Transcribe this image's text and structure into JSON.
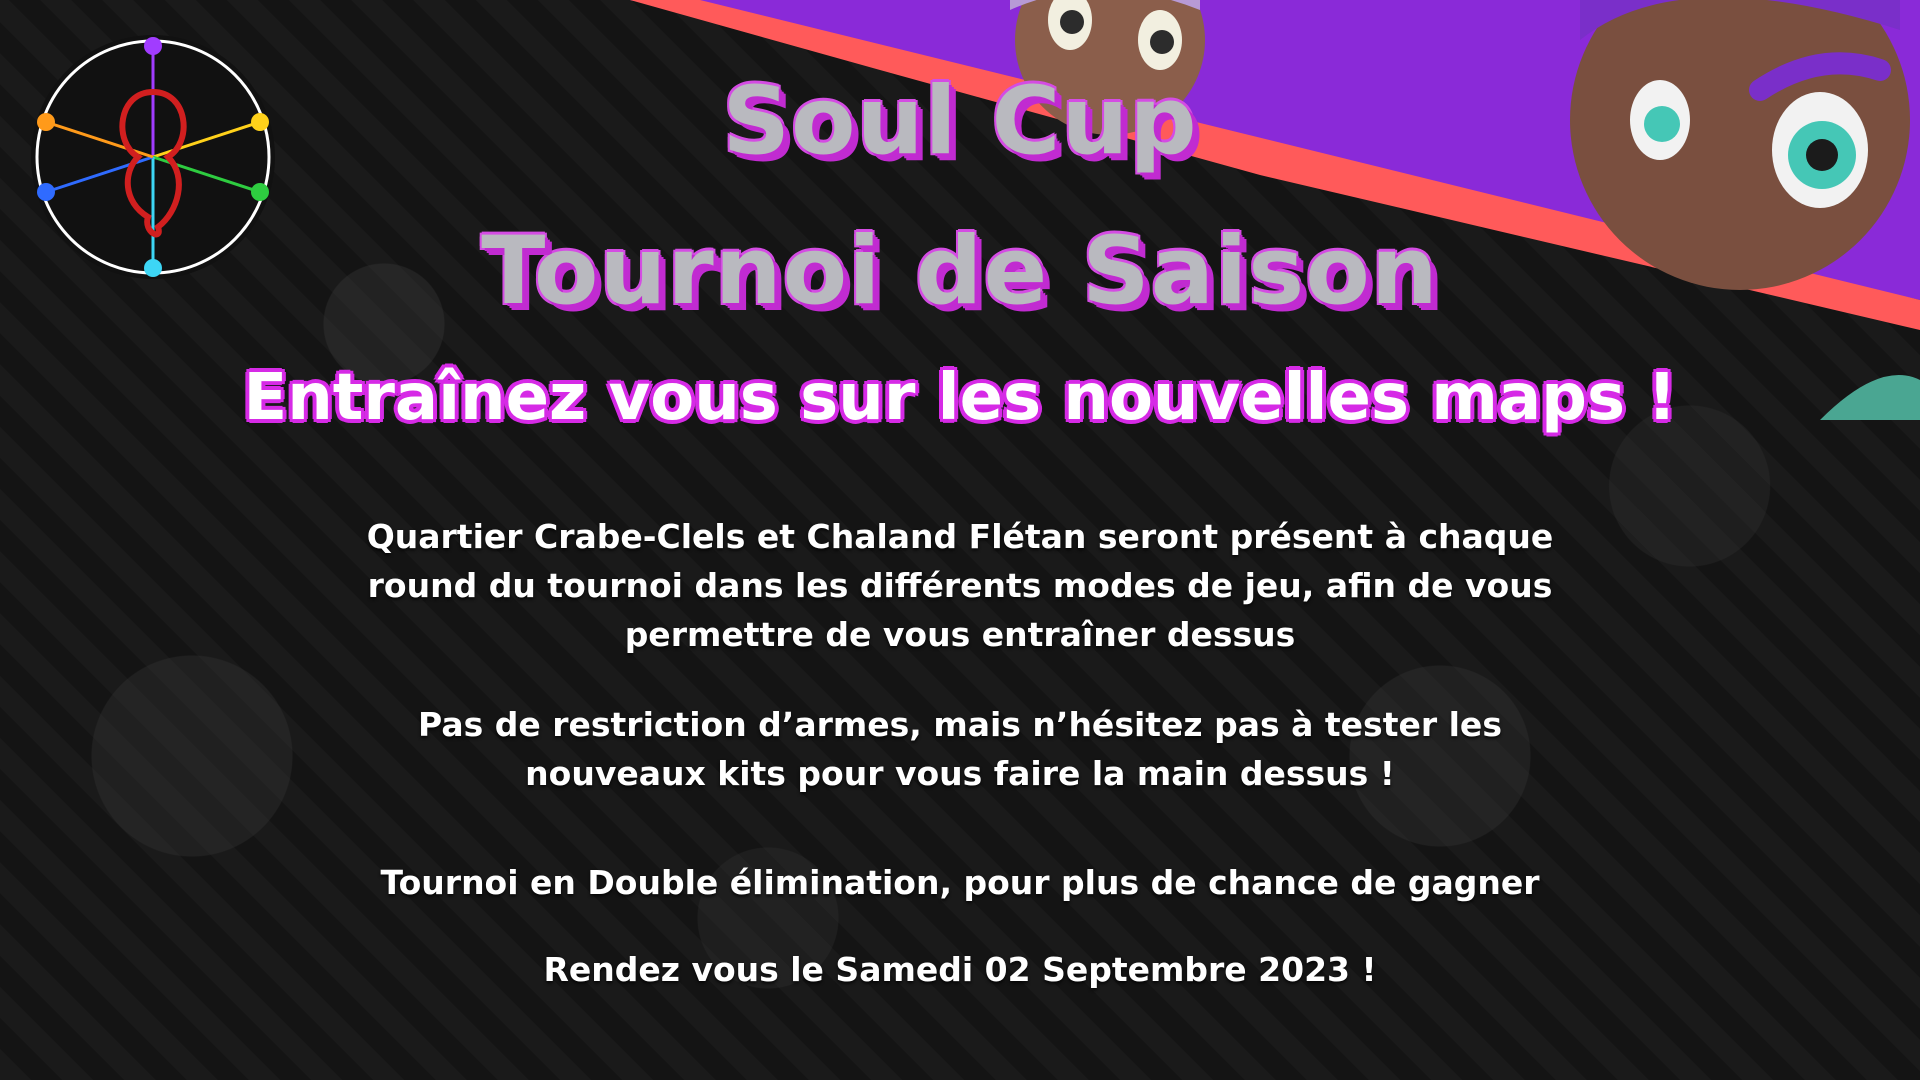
{
  "title": {
    "line1": "Soul Cup",
    "line2": "Tournoi de Saison"
  },
  "subtitle": "Entraînez vous sur les nouvelles maps !",
  "paragraphs": {
    "maps": [
      "Quartier Crabe-Clels et Chaland Flétan seront présent à chaque",
      "round du tournoi dans les différents modes de jeu, afin de vous",
      "permettre de vous entraîner dessus"
    ],
    "weapons": [
      "Pas de restriction d’armes, mais n’hésitez pas à tester les",
      "nouveaux kits pour vous faire la main dessus !"
    ],
    "format": "Tournoi en Double élimination, pour plus de chance de gagner",
    "date": "Rendez vous le Samedi 02 Septembre 2023 !"
  },
  "colors": {
    "background": "#161616",
    "title_fill": "#b9b9bf",
    "title_shadow": "#c12bd1",
    "subtitle_outline": "#d62ae6",
    "banner_purple": "#8a2ad8",
    "banner_red": "#ff5a5a"
  },
  "icons": {
    "logo": "soul-cup-wheel-logo",
    "banner_art": "inkling-characters-artwork"
  }
}
